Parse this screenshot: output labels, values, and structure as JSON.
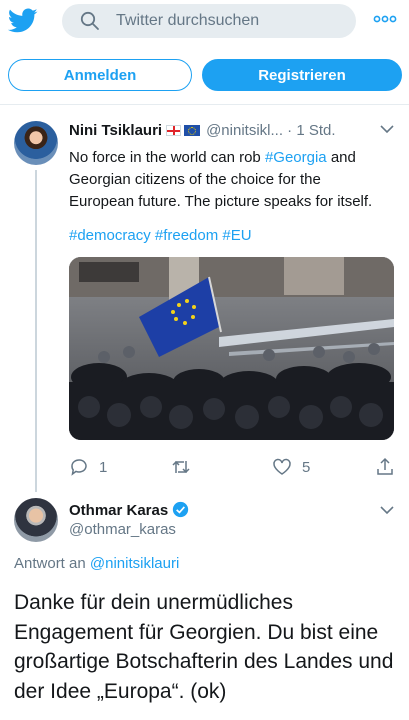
{
  "colors": {
    "accent": "#1da1f2",
    "text": "#14171a",
    "muted": "#657786",
    "search_bg": "#e6ecf0"
  },
  "topbar": {
    "logo_icon": "twitter-bird-icon",
    "search": {
      "placeholder": "Twitter durchsuchen",
      "value": "",
      "icon": "search-icon"
    },
    "more_icon": "more-dots-icon"
  },
  "auth": {
    "login_label": "Anmelden",
    "signup_label": "Registrieren"
  },
  "tweet": {
    "author_name": "Nini Tsiklauri",
    "flags": [
      "flag-georgia-icon",
      "flag-eu-icon"
    ],
    "handle": "@ninitsikl...",
    "separator": "·",
    "time": "1 Std.",
    "text_part1": "No force in the world can rob ",
    "text_link": "#Georgia",
    "text_part2": " and Georgian citizens of the choice for the European future. The picture speaks for itself.",
    "hashtags": "#democracy #freedom #EU",
    "stats": {
      "replies": "1",
      "retweets": "",
      "likes": "5"
    },
    "action_icons": [
      "reply-icon",
      "retweet-icon",
      "like-icon",
      "share-icon"
    ]
  },
  "reply": {
    "author_name": "Othmar Karas",
    "verified_icon": "verified-badge-icon",
    "handle": "@othmar_karas",
    "reply_to_label": "Antwort an",
    "reply_to_handle": "@ninitsiklauri",
    "text": "Danke für dein unermüdliches Engagement für Georgien. Du bist eine großartige Botschafterin des Landes und der Idee „Europa“. (ok)"
  }
}
